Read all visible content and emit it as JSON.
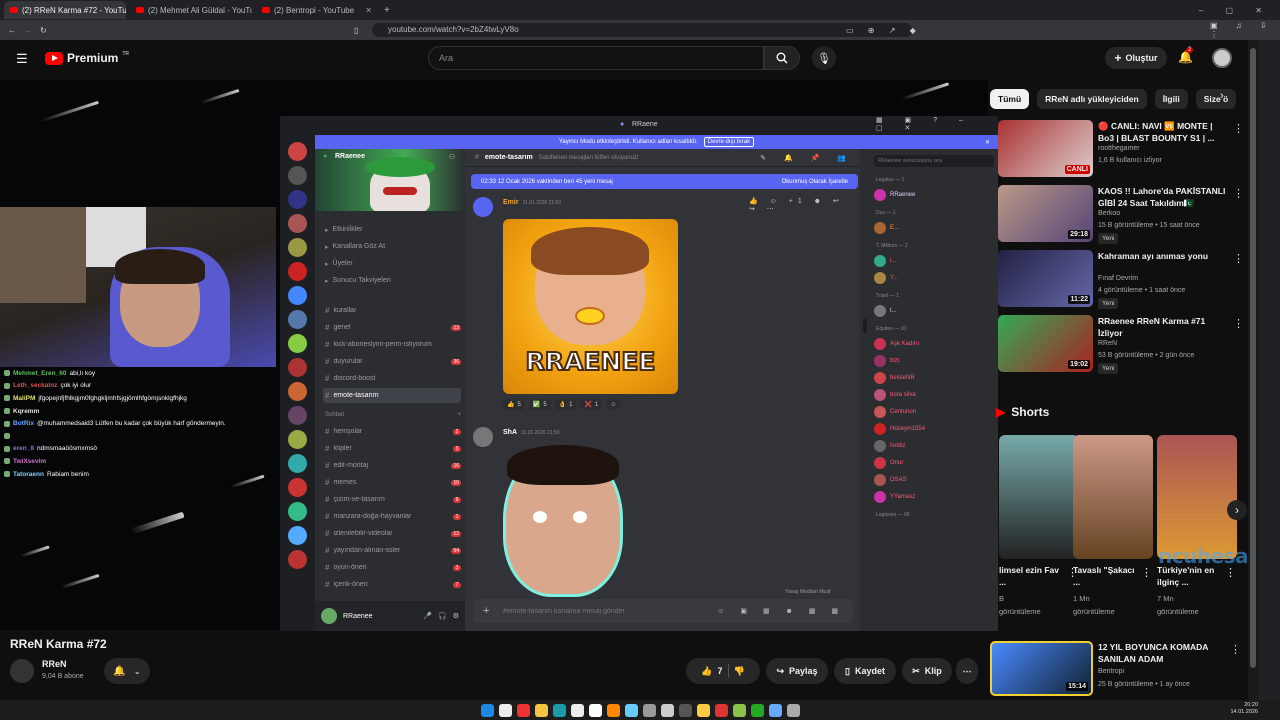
{
  "browser": {
    "tabs": [
      {
        "label": "(2) RReN Karma #72 - YouTube",
        "active": true
      },
      {
        "label": "(2) Mehmet Ali Güldal - YouTube",
        "active": false
      },
      {
        "label": "(2) Bentropi - YouTube",
        "active": false
      }
    ],
    "url": "youtube.com/watch?v=2bZ4twLyV8o"
  },
  "header": {
    "logo": "Premium",
    "logo_sup": "TR",
    "search_placeholder": "Ara",
    "create_label": "Oluştur",
    "notification_count": "2"
  },
  "stream_chat": [
    {
      "user": "Mehmet_Eren_60",
      "msg": "abi,lı koy",
      "color": "#5fbf5f"
    },
    {
      "user": "Leth_seckalnz",
      "msg": "çok iyi olur",
      "color": "#e05050"
    },
    {
      "user": "MaliPM",
      "msg": "jfgopejnfjfhlkgjm0fghgkljmhfsjgjömlhfgömjsnklgfhjkg",
      "color": "#e0e070"
    },
    {
      "user": "Kqremm",
      "msg": "",
      "color": "#e0e0e0"
    },
    {
      "user": "BotRix",
      "msg": "@muhammedsaid3 Lütfen bu kadar çok büyük harf göndermeyin.",
      "color": "#6aa7ff"
    },
    {
      "user": "",
      "msg": "",
      "color": "#e0e0e0"
    },
    {
      "user": "eren_8",
      "msg": "ndmsmaaöösmxmsö",
      "color": "#8a6fd0"
    },
    {
      "user": "TwiXsevim",
      "msg": "",
      "color": "#d070d0"
    },
    {
      "user": "Tatoraenn",
      "msg": "Rabiam benim",
      "color": "#7fd0ff"
    }
  ],
  "discord": {
    "title": "RRaene",
    "banner_text": "Yayıncı Modu etkinleştirildi. Kullanıcı adları kısaltıldı.",
    "banner_button": "Devre dışı bırak",
    "server_name": "RRaenee",
    "menu_items": [
      "Etkinlikler",
      "Kanallara Göz At",
      "Üyeler",
      "Sunucu Takviyeleri"
    ],
    "channels": [
      {
        "name": "kurallar",
        "badge": ""
      },
      {
        "name": "genel",
        "badge": "13"
      },
      {
        "name": "kick-aboneslyim-perm-istiyorum",
        "badge": ""
      },
      {
        "name": "duyurular",
        "badge": "36"
      },
      {
        "name": "discord-boost",
        "badge": ""
      },
      {
        "name": "emote-tasarım",
        "badge": "",
        "selected": true
      }
    ],
    "category": "Sohbet",
    "chat_channels": [
      {
        "name": "hemşolar",
        "badge": "2"
      },
      {
        "name": "klipler",
        "badge": "3"
      },
      {
        "name": "edit-montaj",
        "badge": "16"
      },
      {
        "name": "memes",
        "badge": "10"
      },
      {
        "name": "çizim-ve-tasarım",
        "badge": "9"
      },
      {
        "name": "manzara-doğa-hayvanlar",
        "badge": "1"
      },
      {
        "name": "izlenilebilir-videolar",
        "badge": "12"
      },
      {
        "name": "yayından-alınan-ssler",
        "badge": "54"
      },
      {
        "name": "oyun-öneri",
        "badge": "3"
      },
      {
        "name": "içerik-öneri",
        "badge": "7"
      }
    ],
    "user_name": "RRaenee",
    "channel_header": "emote-tasarım",
    "channel_topic": "Sabitlenen mesajları lütfen okuyunuz!",
    "new_messages": "02:33 12 Ocak 2026 vaktinden beri 45 yeni mesaj",
    "mark_read": "Okunmuş Olarak İşaretle",
    "message1_author": "Emir",
    "message1_time": "11.01.2026 21:50",
    "emote1_text": "RRAENEE",
    "reactions": [
      {
        "emoji": "👍",
        "count": "5"
      },
      {
        "emoji": "✅",
        "count": "5"
      },
      {
        "emoji": "👌",
        "count": "1"
      },
      {
        "emoji": "❌",
        "count": "1"
      }
    ],
    "message2_author": "ShA",
    "message2_time": "11.01.2026 21:50",
    "input_placeholder": "#emote-tasarım kanalına mesaj gönder",
    "typing_note": "Yavaş Moddan Muaf",
    "member_search": "RRaenee sunucusunu ara",
    "member_groups": [
      {
        "label": "Legatus — 1",
        "members": [
          {
            "name": "RRaenee",
            "color": "#e0c8ff"
          }
        ]
      },
      {
        "label": "Dux — 1",
        "members": [
          {
            "name": "E...",
            "color": "#ff9040"
          }
        ]
      },
      {
        "label": "T. Militum — 2",
        "members": [
          {
            "name": "i...",
            "color": "#ff5555"
          },
          {
            "name": "Y...",
            "color": "#ff5555"
          }
        ]
      },
      {
        "label": "Triarii — 1",
        "members": [
          {
            "name": "t...",
            "color": "#ccc"
          }
        ]
      },
      {
        "label": "Equites — 10",
        "members": [
          {
            "name": "Aşk Kadını",
            "color": "#ff5a7a"
          },
          {
            "name": "blzt",
            "color": "#ff5a7a"
          },
          {
            "name": "beisteNR",
            "color": "#ff5a7a"
          },
          {
            "name": "bora silva",
            "color": "#ff5a7a"
          },
          {
            "name": "Centurion",
            "color": "#ff5a7a"
          },
          {
            "name": "Hüseyin1554",
            "color": "#ff5a7a"
          },
          {
            "name": "Isıldız",
            "color": "#ff5a7a"
          },
          {
            "name": "Onur",
            "color": "#ff5a7a"
          },
          {
            "name": "OSAS",
            "color": "#ff5a7a"
          },
          {
            "name": "YYamasz",
            "color": "#ff5a7a"
          }
        ]
      },
      {
        "label": "Legiones — 65",
        "members": []
      }
    ]
  },
  "chips": [
    "Tümü",
    "RReN adlı yükleyiciden",
    "İlgili",
    "Size ö"
  ],
  "recommended": [
    {
      "title": "🔴 CANLI: NAVI 🆚 MONTE | Bo3 | BLAST BOUNTY S1 | ...",
      "channel": "rootthegamer",
      "meta": "1,6 B kullanıcı izliyor",
      "tag": "",
      "duration": "CANLI",
      "live": true
    },
    {
      "title": "KAOS !! Lahore'da PAKİSTANLI GİBİ 24 Saat Takıldım🇵🇰",
      "channel": "Berkoo",
      "meta": "15 B görüntüleme • 15 saat önce",
      "tag": "Yeni",
      "duration": "29:18",
      "live": false
    },
    {
      "title": "Kahraman ayı anımas yonu",
      "channel": "Fınaf Devrim",
      "meta": "4 görüntüleme • 1 saat önce",
      "tag": "Yeni",
      "duration": "11:22",
      "live": false
    },
    {
      "title": "RRaenee RReN Karma #71 İzliyor",
      "channel": "RReN",
      "meta": "53 B görüntüleme • 2 gün önce",
      "tag": "Yeni",
      "duration": "19:02",
      "live": false
    }
  ],
  "shorts_label": "Shorts",
  "shorts": [
    {
      "title": "limsel ezin Fav ...",
      "meta1": "B",
      "meta2": "görüntüleme"
    },
    {
      "title": "Tavaslı \"Şakacı ...",
      "meta1": "1 Mn",
      "meta2": "görüntüleme"
    },
    {
      "title": "Türkiye'nin en ilginç ...",
      "meta1": "7 Mn",
      "meta2": "görüntüleme"
    }
  ],
  "watermark": "ncuhesap.com",
  "last_video": {
    "title": "12 YIL BOYUNCA KOMADA SANILAN ADAM",
    "channel": "Bentropi",
    "meta": "25 B görüntüleme • 1 ay önce",
    "duration": "15:14"
  },
  "video": {
    "title": "RReN Karma #72",
    "channel": "RReN",
    "subscribers": "9,04 B abone",
    "likes": "7",
    "share": "Paylaş",
    "save": "Kaydet",
    "clip": "Klip"
  },
  "clock": {
    "time": "20:20",
    "date": "14.01.2026"
  },
  "colors": {
    "accent": "#ff0000",
    "discord_blurple": "#5865f2"
  }
}
